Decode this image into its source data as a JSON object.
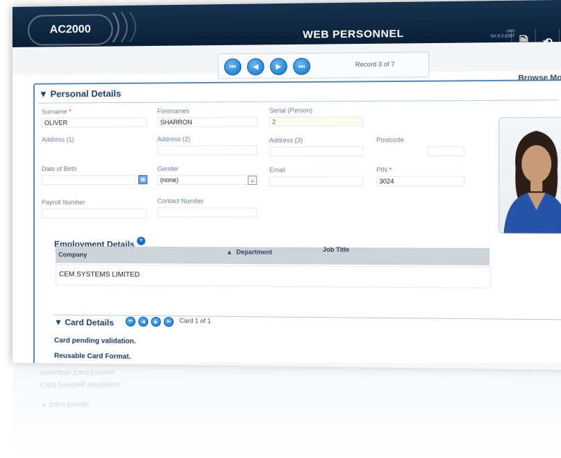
{
  "app": {
    "logo": "AC2000",
    "title": "WEB PERSONNEL",
    "version_line1": "cem",
    "version_line2": "SA 6.0.8367"
  },
  "titlebar_buttons": [
    {
      "name": "document-icon",
      "glyph": "🗎"
    },
    {
      "name": "logout-icon",
      "glyph": "⟲"
    },
    {
      "name": "close-icon",
      "glyph": "✕"
    }
  ],
  "navigation": {
    "first": "⏮",
    "prev": "◀",
    "next": "▶",
    "last": "⏭",
    "record_label": "Record 3 of 7"
  },
  "mode": "Browse Mode",
  "personal": {
    "heading": "▼ Personal Details",
    "surname_label": "Surname",
    "surname_req": "*",
    "surname": "OLIVER",
    "forenames_label": "Forenames",
    "forenames": "SHARRON",
    "serial_label": "Serial (Person)",
    "serial": "2",
    "address1_label": "Address (1)",
    "address2_label": "Address (2)",
    "address3_label": "Address (3)",
    "postcode_label": "Postcode",
    "dob_label": "Date of Birth",
    "gender_label": "Gender",
    "gender": "(none)",
    "email_label": "Email",
    "pin_label": "PIN",
    "pin_req": "*",
    "pin": "3024",
    "payroll_label": "Payroll Number",
    "contact_label": "Contact Number"
  },
  "employment": {
    "heading": "Employment Details",
    "columns": [
      "Company",
      "Department",
      "Job Title"
    ],
    "rows": [
      {
        "company": "CEM SYSTEMS LIMITED"
      }
    ]
  },
  "card": {
    "heading": "▼ Card Details",
    "label": "Card 1 of 1",
    "status1": "Card pending validation.",
    "status2": "Reusable Card Format."
  },
  "colors": {
    "titlebar": "#0f2944",
    "accent": "#1670c2",
    "heading": "#1e3f66"
  }
}
